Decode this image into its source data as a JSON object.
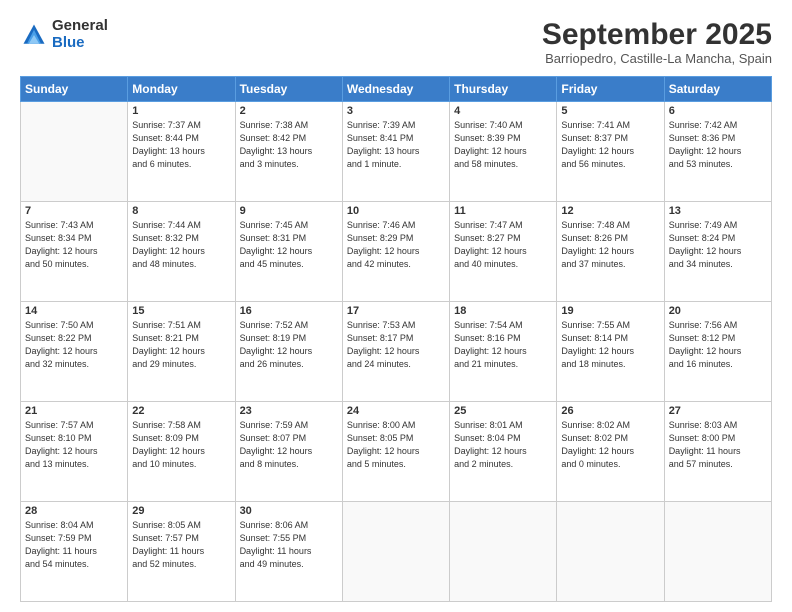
{
  "logo": {
    "general": "General",
    "blue": "Blue"
  },
  "title": "September 2025",
  "location": "Barriopedro, Castille-La Mancha, Spain",
  "days_of_week": [
    "Sunday",
    "Monday",
    "Tuesday",
    "Wednesday",
    "Thursday",
    "Friday",
    "Saturday"
  ],
  "weeks": [
    [
      {
        "day": "",
        "info": ""
      },
      {
        "day": "1",
        "info": "Sunrise: 7:37 AM\nSunset: 8:44 PM\nDaylight: 13 hours\nand 6 minutes."
      },
      {
        "day": "2",
        "info": "Sunrise: 7:38 AM\nSunset: 8:42 PM\nDaylight: 13 hours\nand 3 minutes."
      },
      {
        "day": "3",
        "info": "Sunrise: 7:39 AM\nSunset: 8:41 PM\nDaylight: 13 hours\nand 1 minute."
      },
      {
        "day": "4",
        "info": "Sunrise: 7:40 AM\nSunset: 8:39 PM\nDaylight: 12 hours\nand 58 minutes."
      },
      {
        "day": "5",
        "info": "Sunrise: 7:41 AM\nSunset: 8:37 PM\nDaylight: 12 hours\nand 56 minutes."
      },
      {
        "day": "6",
        "info": "Sunrise: 7:42 AM\nSunset: 8:36 PM\nDaylight: 12 hours\nand 53 minutes."
      }
    ],
    [
      {
        "day": "7",
        "info": "Sunrise: 7:43 AM\nSunset: 8:34 PM\nDaylight: 12 hours\nand 50 minutes."
      },
      {
        "day": "8",
        "info": "Sunrise: 7:44 AM\nSunset: 8:32 PM\nDaylight: 12 hours\nand 48 minutes."
      },
      {
        "day": "9",
        "info": "Sunrise: 7:45 AM\nSunset: 8:31 PM\nDaylight: 12 hours\nand 45 minutes."
      },
      {
        "day": "10",
        "info": "Sunrise: 7:46 AM\nSunset: 8:29 PM\nDaylight: 12 hours\nand 42 minutes."
      },
      {
        "day": "11",
        "info": "Sunrise: 7:47 AM\nSunset: 8:27 PM\nDaylight: 12 hours\nand 40 minutes."
      },
      {
        "day": "12",
        "info": "Sunrise: 7:48 AM\nSunset: 8:26 PM\nDaylight: 12 hours\nand 37 minutes."
      },
      {
        "day": "13",
        "info": "Sunrise: 7:49 AM\nSunset: 8:24 PM\nDaylight: 12 hours\nand 34 minutes."
      }
    ],
    [
      {
        "day": "14",
        "info": "Sunrise: 7:50 AM\nSunset: 8:22 PM\nDaylight: 12 hours\nand 32 minutes."
      },
      {
        "day": "15",
        "info": "Sunrise: 7:51 AM\nSunset: 8:21 PM\nDaylight: 12 hours\nand 29 minutes."
      },
      {
        "day": "16",
        "info": "Sunrise: 7:52 AM\nSunset: 8:19 PM\nDaylight: 12 hours\nand 26 minutes."
      },
      {
        "day": "17",
        "info": "Sunrise: 7:53 AM\nSunset: 8:17 PM\nDaylight: 12 hours\nand 24 minutes."
      },
      {
        "day": "18",
        "info": "Sunrise: 7:54 AM\nSunset: 8:16 PM\nDaylight: 12 hours\nand 21 minutes."
      },
      {
        "day": "19",
        "info": "Sunrise: 7:55 AM\nSunset: 8:14 PM\nDaylight: 12 hours\nand 18 minutes."
      },
      {
        "day": "20",
        "info": "Sunrise: 7:56 AM\nSunset: 8:12 PM\nDaylight: 12 hours\nand 16 minutes."
      }
    ],
    [
      {
        "day": "21",
        "info": "Sunrise: 7:57 AM\nSunset: 8:10 PM\nDaylight: 12 hours\nand 13 minutes."
      },
      {
        "day": "22",
        "info": "Sunrise: 7:58 AM\nSunset: 8:09 PM\nDaylight: 12 hours\nand 10 minutes."
      },
      {
        "day": "23",
        "info": "Sunrise: 7:59 AM\nSunset: 8:07 PM\nDaylight: 12 hours\nand 8 minutes."
      },
      {
        "day": "24",
        "info": "Sunrise: 8:00 AM\nSunset: 8:05 PM\nDaylight: 12 hours\nand 5 minutes."
      },
      {
        "day": "25",
        "info": "Sunrise: 8:01 AM\nSunset: 8:04 PM\nDaylight: 12 hours\nand 2 minutes."
      },
      {
        "day": "26",
        "info": "Sunrise: 8:02 AM\nSunset: 8:02 PM\nDaylight: 12 hours\nand 0 minutes."
      },
      {
        "day": "27",
        "info": "Sunrise: 8:03 AM\nSunset: 8:00 PM\nDaylight: 11 hours\nand 57 minutes."
      }
    ],
    [
      {
        "day": "28",
        "info": "Sunrise: 8:04 AM\nSunset: 7:59 PM\nDaylight: 11 hours\nand 54 minutes."
      },
      {
        "day": "29",
        "info": "Sunrise: 8:05 AM\nSunset: 7:57 PM\nDaylight: 11 hours\nand 52 minutes."
      },
      {
        "day": "30",
        "info": "Sunrise: 8:06 AM\nSunset: 7:55 PM\nDaylight: 11 hours\nand 49 minutes."
      },
      {
        "day": "",
        "info": ""
      },
      {
        "day": "",
        "info": ""
      },
      {
        "day": "",
        "info": ""
      },
      {
        "day": "",
        "info": ""
      }
    ]
  ]
}
